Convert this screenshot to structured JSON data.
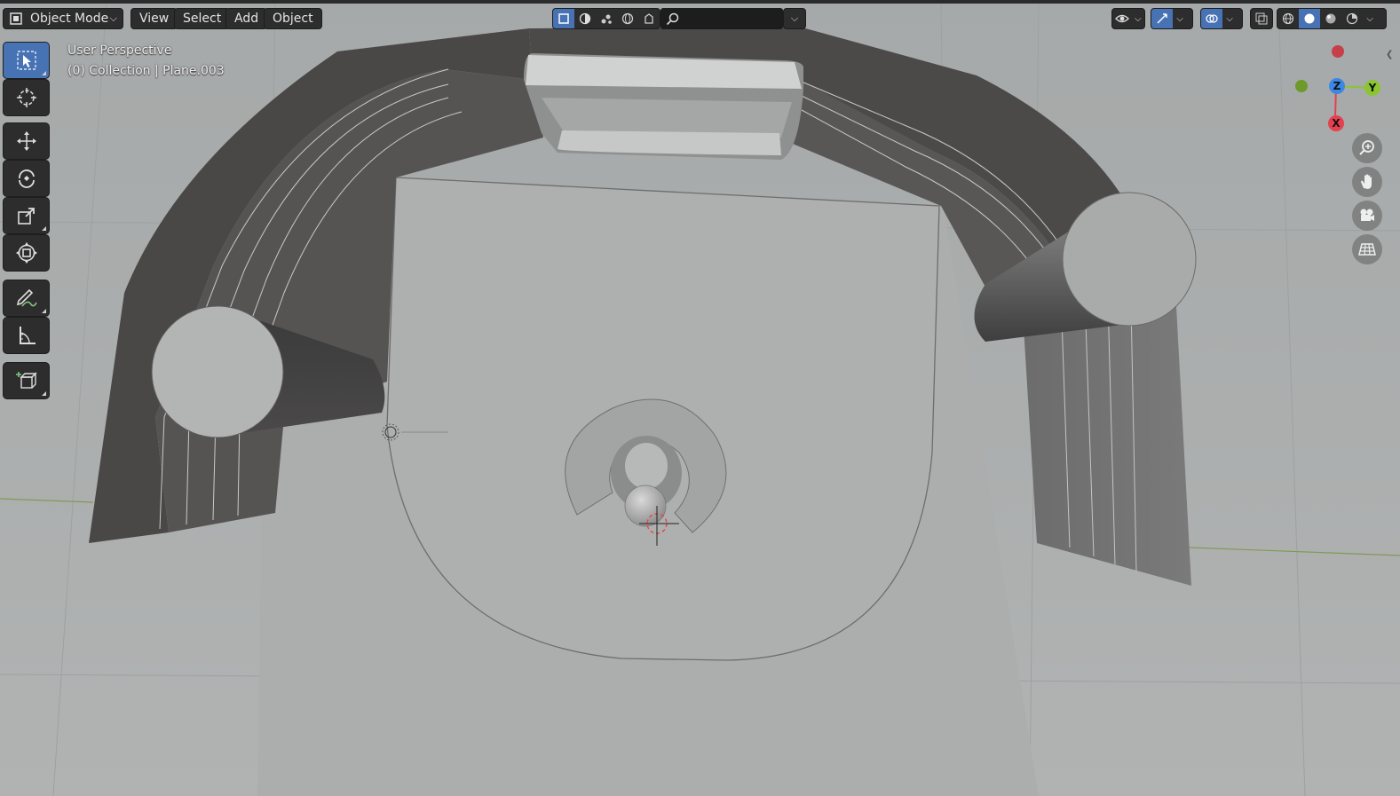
{
  "header": {
    "mode_label": "Object Mode",
    "menus": [
      "View",
      "Select",
      "Add",
      "Object"
    ],
    "search_placeholder": ""
  },
  "overlay": {
    "view_name": "User Perspective",
    "collection_info": "(0) Collection | Plane.003"
  },
  "gizmo": {
    "axis_z": "Z",
    "axis_y": "Y",
    "axis_x": "X"
  },
  "colors": {
    "accent": "#4772b3",
    "axis_x": "#e5404f",
    "axis_y": "#8bc531",
    "axis_z": "#3d87e4",
    "viewport_bg": "#a8abab"
  },
  "toolbar": {
    "tools": [
      "select-box",
      "cursor",
      "move",
      "rotate",
      "scale",
      "transform",
      "annotate",
      "measure",
      "add-cube"
    ]
  },
  "navigation": [
    "zoom",
    "pan",
    "camera",
    "ortho-grid"
  ]
}
